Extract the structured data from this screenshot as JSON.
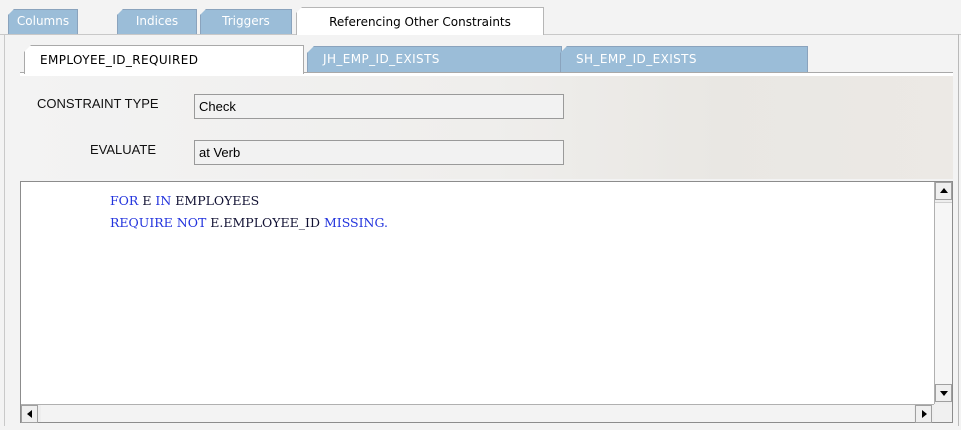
{
  "top_tabs": [
    {
      "label": "Columns",
      "active": false
    },
    {
      "label": "Indices",
      "active": false
    },
    {
      "label": "Triggers",
      "active": false
    },
    {
      "label": "Referencing Other Constraints",
      "active": true
    }
  ],
  "constraint_tabs": [
    {
      "label": "EMPLOYEE_ID_REQUIRED",
      "active": true
    },
    {
      "label": "JH_EMP_ID_EXISTS",
      "active": false
    },
    {
      "label": "SH_EMP_ID_EXISTS",
      "active": false
    }
  ],
  "form": {
    "constraint_type_label": "CONSTRAINT TYPE",
    "constraint_type_value": "Check",
    "evaluate_label": "EVALUATE",
    "evaluate_value": "at Verb"
  },
  "code": {
    "line1": {
      "kw1": "FOR",
      "t1": " E ",
      "kw2": "IN",
      "t2": " EMPLOYEES"
    },
    "line2": {
      "kw1": "REQUIRE",
      "t1": " ",
      "kw2": "NOT",
      "t2": " E.EMPLOYEE_ID ",
      "kw3": "MISSING."
    }
  },
  "colors": {
    "inactive_tab": "#9bbdd8",
    "keyword": "#2233dd",
    "active_tab": "#ffffff"
  },
  "icons": [
    "scroll-up-arrow-icon",
    "scroll-down-arrow-icon",
    "scroll-left-arrow-icon",
    "scroll-right-arrow-icon"
  ]
}
